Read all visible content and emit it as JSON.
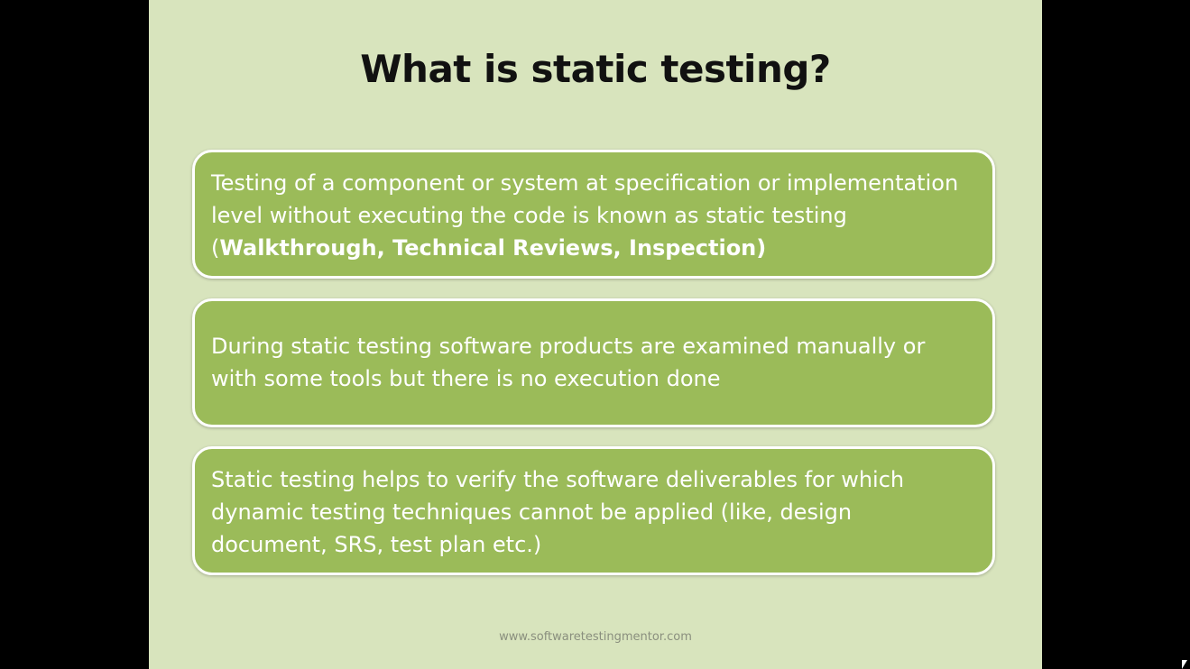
{
  "slide": {
    "title": "What is static testing?",
    "boxes": [
      {
        "text_before": "Testing of a component or system at specification or implementation level without executing the code is known as static testing (",
        "bold": "Walkthrough, Technical Reviews, Inspection)"
      },
      {
        "text": "During static testing software products are examined manually or with some tools but there is no execution done"
      },
      {
        "text": "Static testing helps to verify the software deliverables for which dynamic testing techniques cannot be applied (like, design document, SRS, test plan etc.)"
      }
    ],
    "footer": "www.softwaretestingmentor.com"
  },
  "colors": {
    "letterbox": "#000000",
    "slide_background": "#d8e4bd",
    "box_fill": "#9bbb59",
    "box_border": "#ffffff",
    "box_text": "#ffffff",
    "title_text": "#111111"
  }
}
